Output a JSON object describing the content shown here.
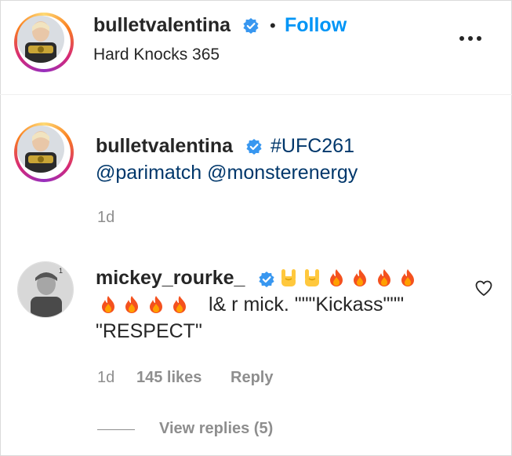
{
  "post_header": {
    "username": "bulletvalentina",
    "follow_separator": "•",
    "follow_label": "Follow",
    "location": "Hard Knocks 365"
  },
  "caption": {
    "username": "bulletvalentina",
    "hashtag": "#UFC261",
    "mention_1": "@parimatch",
    "mention_2": "@monsterenergy",
    "time": "1d"
  },
  "comment": {
    "username": "mickey_rourke_",
    "text_line2": "l& r mick. \"\"\"Kickass\"\"\"",
    "text_line3": "\"RESPECT\"",
    "time": "1d",
    "likes": "145 likes",
    "reply_label": "Reply",
    "view_replies": "View replies (5)"
  },
  "emojis": {
    "line1": [
      "sign-of-horns",
      "sign-of-horns",
      "fire",
      "fire",
      "fire",
      "fire"
    ],
    "line2": [
      "fire",
      "fire",
      "fire",
      "fire"
    ]
  },
  "colors": {
    "accent_blue": "#0095f6",
    "verified_blue": "#3897f0",
    "secondary_text": "#8e8e8e",
    "link_text": "#00376b"
  }
}
